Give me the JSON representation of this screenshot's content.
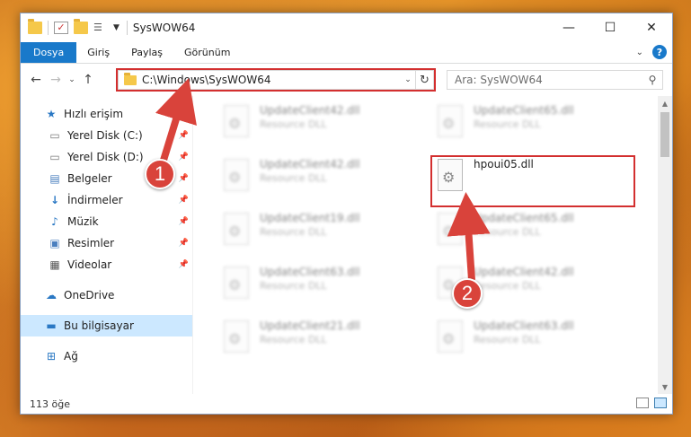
{
  "window": {
    "title": "SysWOW64",
    "minimize_glyph": "—",
    "maximize_glyph": "☐",
    "close_glyph": "✕"
  },
  "ribbon": {
    "tabs": [
      "Dosya",
      "Giriş",
      "Paylaş",
      "Görünüm"
    ],
    "help_glyph": "?"
  },
  "nav": {
    "address": "C:\\Windows\\SysWOW64",
    "search_placeholder": "Ara: SysWOW64"
  },
  "sidebar": {
    "items": [
      {
        "label": "Hızlı erişim",
        "icon": "star-icon"
      },
      {
        "label": "Yerel Disk (C:)",
        "icon": "drive-icon"
      },
      {
        "label": "Yerel Disk (D:)",
        "icon": "drive-icon"
      },
      {
        "label": "Belgeler",
        "icon": "documents-icon"
      },
      {
        "label": "İndirmeler",
        "icon": "download-icon"
      },
      {
        "label": "Müzik",
        "icon": "music-icon"
      },
      {
        "label": "Resimler",
        "icon": "pictures-icon"
      },
      {
        "label": "Videolar",
        "icon": "video-icon"
      },
      {
        "label": "OneDrive",
        "icon": "cloud-icon"
      },
      {
        "label": "Bu bilgisayar",
        "icon": "computer-icon"
      },
      {
        "label": "Ağ",
        "icon": "network-icon"
      }
    ]
  },
  "files": [
    {
      "name": "UpdateClient42.dll",
      "type": "Resource DLL"
    },
    {
      "name": "UpdateClient65.dll",
      "type": "Resource DLL"
    },
    {
      "name": "UpdateClient42.dll",
      "type": "Resource DLL"
    },
    {
      "name": "hpoui05.dll",
      "type": ""
    },
    {
      "name": "UpdateClient19.dll",
      "type": "Resource DLL"
    },
    {
      "name": "UpdateClient65.dll",
      "type": "Resource DLL"
    },
    {
      "name": "UpdateClient63.dll",
      "type": "Resource DLL"
    },
    {
      "name": "UpdateClient42.dll",
      "type": "Resource DLL"
    },
    {
      "name": "UpdateClient21.dll",
      "type": "Resource DLL"
    },
    {
      "name": "UpdateClient63.dll",
      "type": "Resource DLL"
    }
  ],
  "status": {
    "item_count": "113 öğe"
  },
  "callouts": {
    "one": "1",
    "two": "2"
  },
  "colors": {
    "accent": "#1979ca",
    "highlight": "#d32f2f",
    "callout": "#d9433b",
    "selected": "#cce8ff"
  }
}
